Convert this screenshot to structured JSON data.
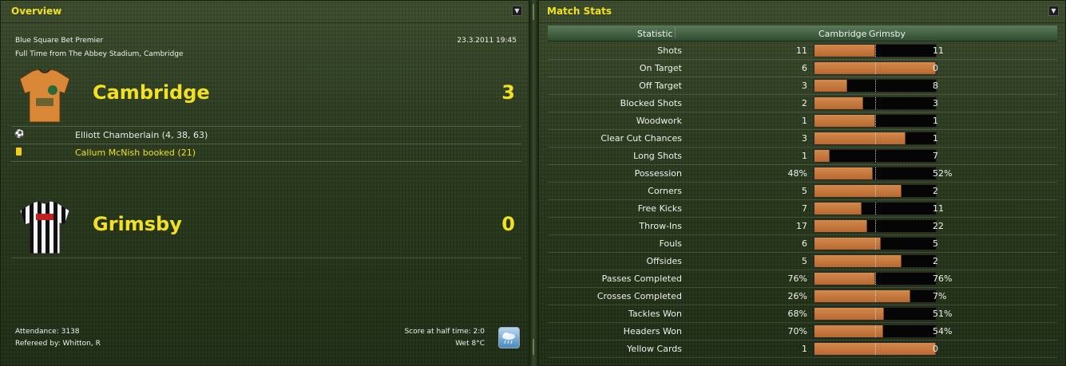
{
  "overview": {
    "title": "Overview",
    "competition": "Blue Square Bet Premier",
    "datetime": "23.3.2011 19:45",
    "venue_line": "Full Time from The Abbey Stadium, Cambridge",
    "home": {
      "name": "Cambridge",
      "score": "3",
      "events": [
        {
          "icon": "football-icon",
          "text": "Elliott Chamberlain (4, 38, 63)",
          "color": "#f0f0f0"
        },
        {
          "icon": "yellow-card-icon",
          "text": "Callum McNish booked (21)",
          "color": "#f2e022"
        }
      ]
    },
    "away": {
      "name": "Grimsby",
      "score": "0"
    },
    "attendance": "Attendance: 3138",
    "referee": "Refereed by: Whitton, R",
    "halftime": "Score at half time: 2:0",
    "weather": "Wet 8°C",
    "weather_icon": "rain-cloud-icon"
  },
  "stats": {
    "title": "Match Stats",
    "columns": {
      "statistic": "Statistic",
      "home": "Cambridge",
      "away": "Grimsby"
    },
    "rows": [
      {
        "label": "Shots",
        "home": "11",
        "away": "11",
        "home_share": 0.5
      },
      {
        "label": "On Target",
        "home": "6",
        "away": "0",
        "home_share": 1.0
      },
      {
        "label": "Off Target",
        "home": "3",
        "away": "8",
        "home_share": 0.273
      },
      {
        "label": "Blocked Shots",
        "home": "2",
        "away": "3",
        "home_share": 0.4
      },
      {
        "label": "Woodwork",
        "home": "1",
        "away": "1",
        "home_share": 0.5
      },
      {
        "label": "Clear Cut Chances",
        "home": "3",
        "away": "1",
        "home_share": 0.75
      },
      {
        "label": "Long Shots",
        "home": "1",
        "away": "7",
        "home_share": 0.125
      },
      {
        "label": "Possession",
        "home": "48%",
        "away": "52%",
        "home_share": 0.48
      },
      {
        "label": "Corners",
        "home": "5",
        "away": "2",
        "home_share": 0.714
      },
      {
        "label": "Free Kicks",
        "home": "7",
        "away": "11",
        "home_share": 0.389
      },
      {
        "label": "Throw-Ins",
        "home": "17",
        "away": "22",
        "home_share": 0.436
      },
      {
        "label": "Fouls",
        "home": "6",
        "away": "5",
        "home_share": 0.545
      },
      {
        "label": "Offsides",
        "home": "5",
        "away": "2",
        "home_share": 0.714
      },
      {
        "label": "Passes Completed",
        "home": "76%",
        "away": "76%",
        "home_share": 0.5
      },
      {
        "label": "Crosses Completed",
        "home": "26%",
        "away": "7%",
        "home_share": 0.788
      },
      {
        "label": "Tackles Won",
        "home": "68%",
        "away": "51%",
        "home_share": 0.571
      },
      {
        "label": "Headers Won",
        "home": "70%",
        "away": "54%",
        "home_share": 0.565
      },
      {
        "label": "Yellow Cards",
        "home": "1",
        "away": "0",
        "home_share": 1.0
      }
    ]
  },
  "colors": {
    "accent": "#f2e022",
    "bar_home": "#c87840",
    "bar_away": "#050505"
  }
}
